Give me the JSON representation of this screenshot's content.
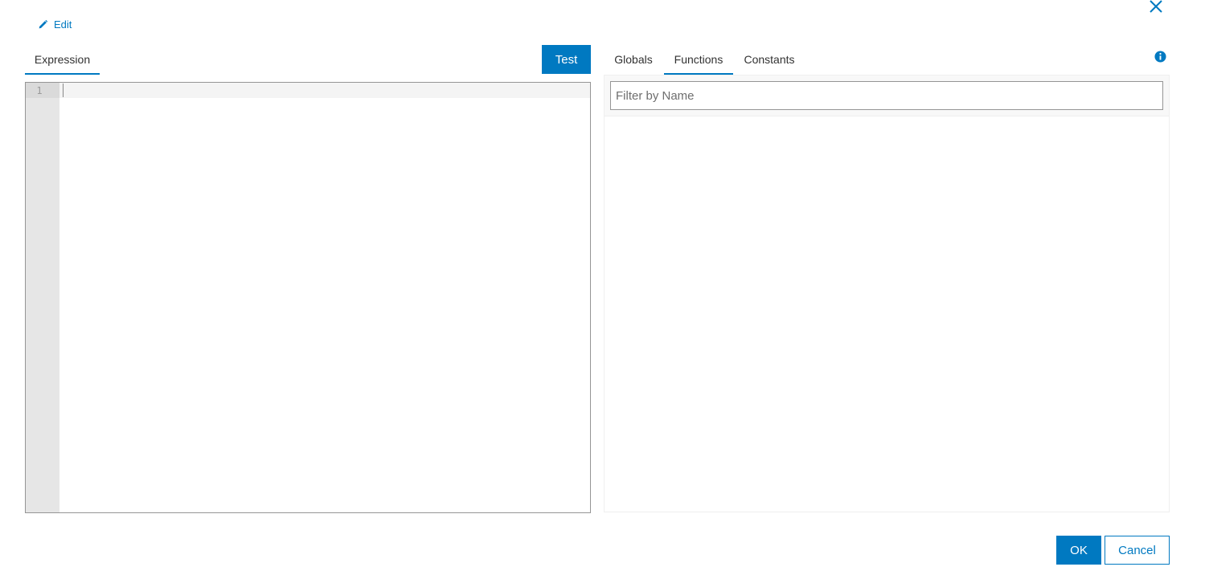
{
  "header": {
    "edit_label": "Edit",
    "edit_icon": "pencil-icon",
    "close_icon": "close-icon"
  },
  "left_panel": {
    "tab_label": "Expression",
    "test_label": "Test",
    "editor": {
      "line_numbers": [
        "1"
      ],
      "content": ""
    }
  },
  "right_panel": {
    "tabs": [
      {
        "label": "Globals",
        "active": false
      },
      {
        "label": "Functions",
        "active": true
      },
      {
        "label": "Constants",
        "active": false
      }
    ],
    "info_icon": "info-icon",
    "filter": {
      "placeholder": "Filter by Name",
      "value": ""
    }
  },
  "footer": {
    "ok_label": "OK",
    "cancel_label": "Cancel"
  },
  "colors": {
    "accent": "#0079c1",
    "gutter": "#e6e6e6",
    "border": "#959595"
  }
}
